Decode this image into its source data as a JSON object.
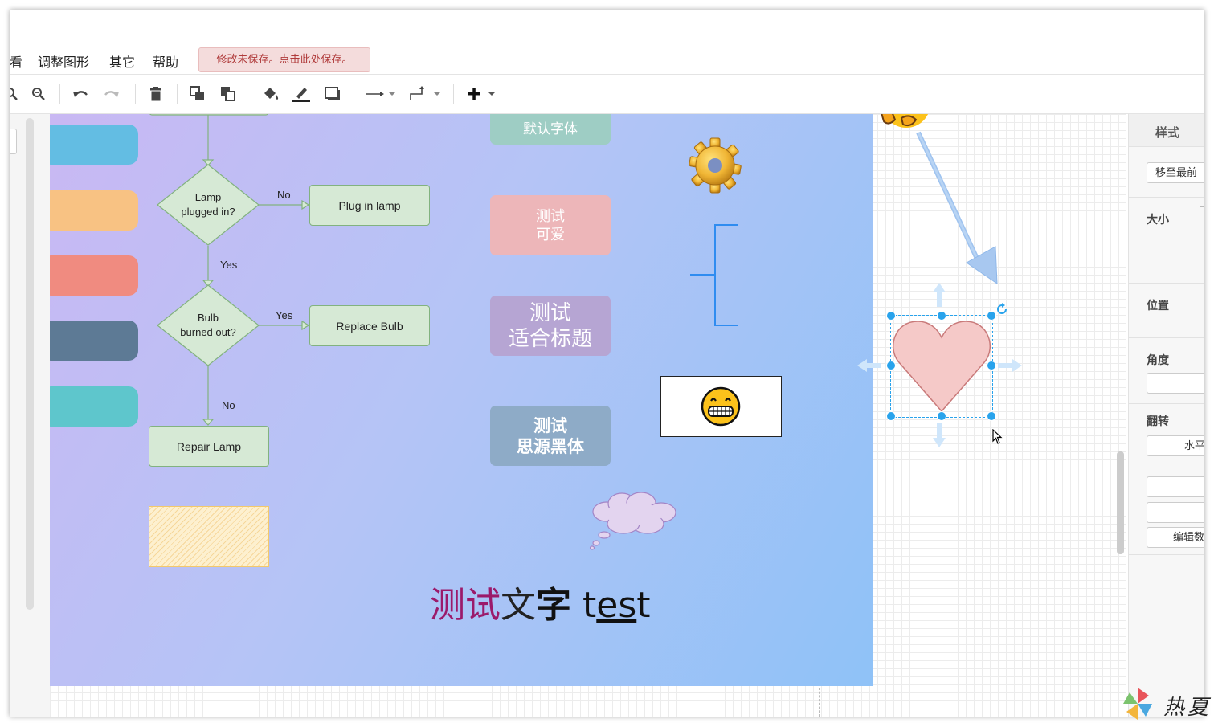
{
  "menu": {
    "items": [
      "看",
      "调整图形",
      "其它",
      "帮助"
    ],
    "unsaved_notice": "修改未保存。点击此处保存。"
  },
  "toolbar": {
    "icons": [
      "zoom-in-icon",
      "zoom-out-icon",
      "undo-icon",
      "redo-icon",
      "delete-icon",
      "to-front-icon",
      "to-back-icon",
      "fill-color-icon",
      "line-color-icon",
      "shadow-icon",
      "connection-icon",
      "waypoint-icon",
      "insert-icon"
    ]
  },
  "flowchart": {
    "decision1": [
      "Lamp",
      "plugged in?"
    ],
    "decision2": [
      "Bulb",
      "burned out?"
    ],
    "plug_in": "Plug in lamp",
    "replace": "Replace Bulb",
    "repair": "Repair Lamp",
    "label_no1": "No",
    "label_yes1": "Yes",
    "label_yes2": "Yes",
    "label_no2": "No"
  },
  "cards": {
    "default_font": "默认字体",
    "cute": [
      "测试",
      "可爱"
    ],
    "title": [
      "测试",
      "适合标题"
    ],
    "heiti": [
      "测试",
      "思源黑体"
    ]
  },
  "rich_text": {
    "part1": "测试",
    "part2": "文",
    "part3": "字",
    "part4": "t",
    "part5": "es",
    "part6": "t"
  },
  "colors": {
    "pill1": "#63bde3",
    "pill2": "#f8c283",
    "pill3": "#f08b80",
    "pill4": "#5d7a95",
    "pill5": "#5ec6cc",
    "heart_fill": "#f5c9c8",
    "heart_stroke": "#c97a7a",
    "selection": "#29a3ec"
  },
  "format_panel": {
    "tab": "样式",
    "to_front": "移至最前",
    "size": "大小",
    "position": "位置",
    "angle": "角度",
    "flip": "翻转",
    "flip_horizontal": "水平",
    "edit_data": "编辑数据"
  },
  "watermark": "热夏"
}
